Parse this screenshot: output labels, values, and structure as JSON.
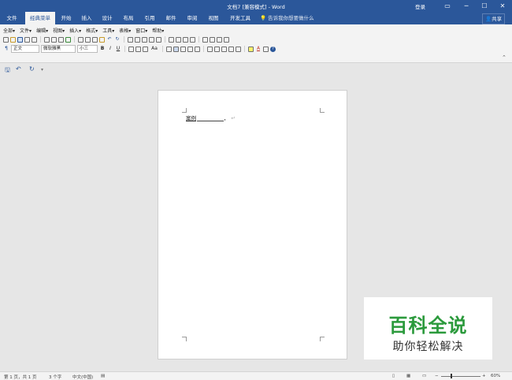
{
  "titlebar": {
    "title": "文档7 [兼容模式] - Word",
    "login": "登录",
    "ribbon_display_icon": "ribbon-display-icon",
    "minimize": "─",
    "restore": "☐",
    "close": "✕"
  },
  "tabs": [
    "文件",
    "经典菜单",
    "开始",
    "插入",
    "设计",
    "布局",
    "引用",
    "邮件",
    "审阅",
    "视图",
    "开发工具"
  ],
  "active_tab": "经典菜单",
  "tellme": "告诉我你想要做什么",
  "share": "共享",
  "classic_menu": [
    "全部",
    "文件",
    "编辑",
    "视图",
    "插入",
    "格式",
    "工具",
    "表格",
    "窗口",
    "帮助"
  ],
  "format": {
    "style": "正文",
    "font": "微软雅黑",
    "size": "小三",
    "bold": "B",
    "italic": "I",
    "underline": "U",
    "aa": "Aa"
  },
  "quick_access": {
    "save_icon": "save-icon",
    "undo_icon": "undo-icon",
    "redo_icon": "redo-icon"
  },
  "document": {
    "text": "案例",
    "trailing": "，"
  },
  "watermark": {
    "title": "百科全说",
    "subtitle": "助你轻松解决"
  },
  "status": {
    "page": "第 1 页，共 1 页",
    "words": "3 个字",
    "language": "中文(中国)",
    "zoom": "60%"
  },
  "colors": {
    "accent": "#2b579a",
    "watermark": "#2b9a3c"
  }
}
